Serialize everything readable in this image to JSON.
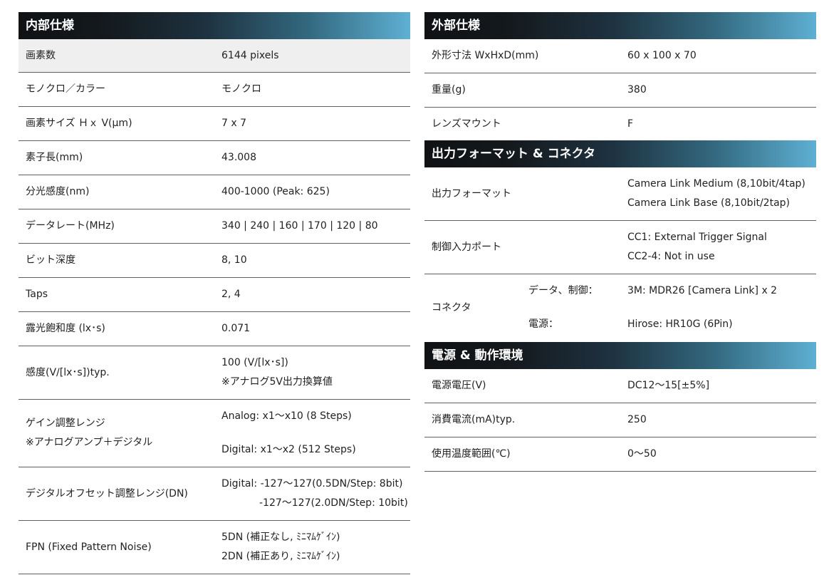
{
  "internal": {
    "header": "内部仕様",
    "rows": [
      {
        "label": "画素数",
        "value": "6144 pixels"
      },
      {
        "label": "モノクロ／カラー",
        "value": "モノクロ"
      },
      {
        "label": "画素サイズ Ｈｘ V(μm)",
        "value": "7 x 7"
      },
      {
        "label": "素子長(mm)",
        "value": "43.008"
      },
      {
        "label": "分光感度(nm)",
        "value": "400-1000 (Peak: 625)"
      },
      {
        "label": "データレート(MHz)",
        "value": "340 | 240 | 160 | 170 | 120 | 80"
      },
      {
        "label": "ビット深度",
        "value": "8, 10"
      },
      {
        "label": "Taps",
        "value": "2, 4"
      },
      {
        "label": "露光飽和度 (lx･s)",
        "value": "0.071"
      },
      {
        "label": "感度(V/[lx･s])typ.",
        "value": "100 (V/[lx･s])",
        "value2": "※アナログ5V出力換算値"
      },
      {
        "label": "ゲイン調整レンジ",
        "label2": "※アナログアンプ＋デジタル",
        "value": "Analog: x1～x10 (8 Steps)",
        "value2": "Digital: x1～x2 (512 Steps)"
      },
      {
        "label": "デジタルオフセット調整レンジ(DN)",
        "value": "Digital: -127～127(0.5DN/Step: 8bit)",
        "value2": "-127～127(2.0DN/Step: 10bit)"
      },
      {
        "label": "FPN (Fixed Pattern Noise)",
        "value": "5DN (補正なし, ﾐﾆﾏﾑｹﾞｲﾝ)",
        "value2": "2DN (補正あり, ﾐﾆﾏﾑｹﾞｲﾝ)"
      }
    ]
  },
  "external": {
    "header": "外部仕様",
    "rows": [
      {
        "label": "外形寸法 WxHxD(mm)",
        "value": "60 x 100 x 70"
      },
      {
        "label": "重量(g)",
        "value": "380"
      },
      {
        "label": "レンズマウント",
        "value": "F"
      }
    ]
  },
  "output": {
    "header": "出力フォーマット & コネクタ",
    "format": {
      "label": "出力フォーマット",
      "value": "Camera Link Medium (8,10bit/4tap)",
      "value2": "Camera Link Base (8,10bit/2tap)"
    },
    "control": {
      "label": "制御入力ポート",
      "value": "CC1: External Trigger Signal",
      "value2": "CC2-4: Not in use"
    },
    "connector": {
      "label": "コネクタ",
      "data_label": "データ、制御：",
      "data_value": "3M: MDR26 [Camera Link] x 2",
      "power_label": "電源：",
      "power_value": "Hirose: HR10G (6Pin)"
    }
  },
  "power": {
    "header": "電源 & 動作環境",
    "rows": [
      {
        "label": "電源電圧(V)",
        "value": "DC12～15[±5%]"
      },
      {
        "label": "消費電流(mA)typ.",
        "value": "250"
      },
      {
        "label": "使用温度範囲(℃)",
        "value": "0～50"
      }
    ]
  }
}
